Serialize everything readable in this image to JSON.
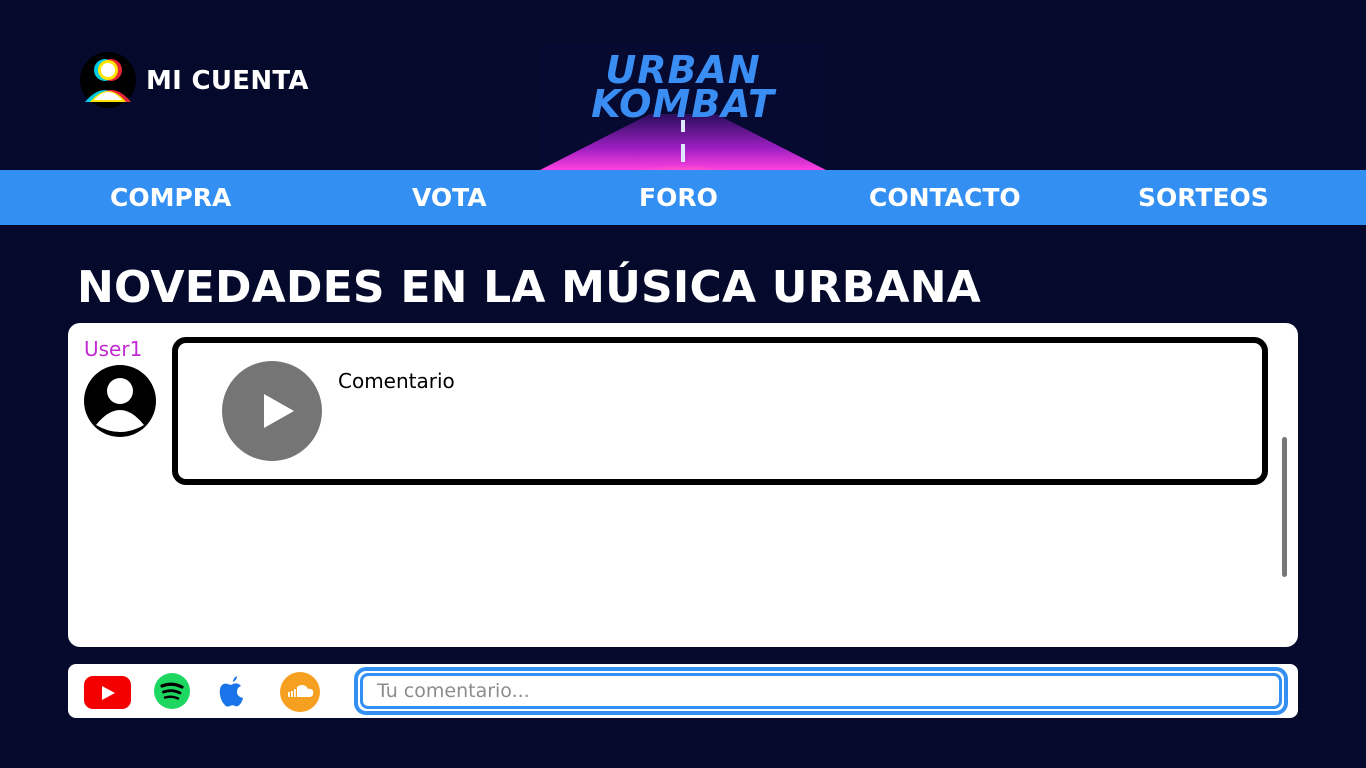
{
  "header": {
    "account_label": "MI CUENTA",
    "logo_line1": "URBAN",
    "logo_line2": "KOMBAT"
  },
  "nav": {
    "items": [
      {
        "label": "COMPRA"
      },
      {
        "label": "VOTA"
      },
      {
        "label": "FORO"
      },
      {
        "label": "CONTACTO"
      },
      {
        "label": "SORTEOS"
      }
    ]
  },
  "main": {
    "headline": "NOVEDADES EN LA MÚSICA URBANA",
    "posts": [
      {
        "username": "User1",
        "comment": "Comentario"
      }
    ]
  },
  "footer": {
    "services": [
      {
        "icon": "youtube-icon",
        "color": "#f40000"
      },
      {
        "icon": "spotify-icon",
        "color": "#1ed760"
      },
      {
        "icon": "apple-music-icon",
        "color": "#1a73e8"
      },
      {
        "icon": "soundcloud-icon",
        "color": "#f5a021"
      }
    ],
    "comment_placeholder": "Tu comentario..."
  },
  "colors": {
    "background": "#050a2c",
    "nav": "#3390f2",
    "username": "#c02ad0",
    "logo": "#3a8ef3"
  }
}
